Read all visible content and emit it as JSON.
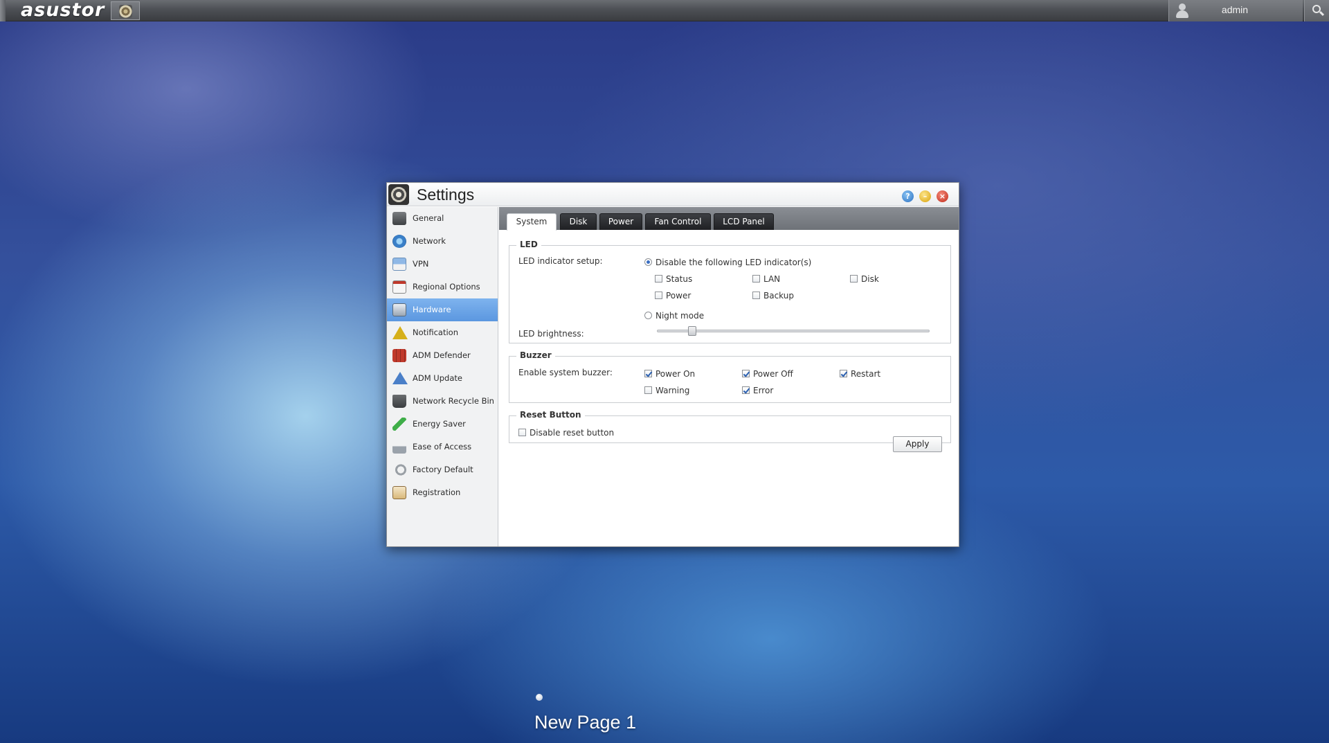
{
  "topbar": {
    "brand": "asustor",
    "user": "admin"
  },
  "window": {
    "title": "Settings",
    "sidebar": {
      "items": [
        {
          "label": "General",
          "icon": "general-icon"
        },
        {
          "label": "Network",
          "icon": "network-globe-icon"
        },
        {
          "label": "VPN",
          "icon": "vpn-house-icon"
        },
        {
          "label": "Regional Options",
          "icon": "calendar-clock-icon"
        },
        {
          "label": "Hardware",
          "icon": "hardware-icon",
          "active": true
        },
        {
          "label": "Notification",
          "icon": "warning-icon"
        },
        {
          "label": "ADM Defender",
          "icon": "firewall-icon"
        },
        {
          "label": "ADM Update",
          "icon": "update-arrow-icon"
        },
        {
          "label": "Network Recycle Bin",
          "icon": "recycle-bin-icon"
        },
        {
          "label": "Energy Saver",
          "icon": "leaf-icon"
        },
        {
          "label": "Ease of Access",
          "icon": "ease-access-icon"
        },
        {
          "label": "Factory Default",
          "icon": "undo-arrow-icon"
        },
        {
          "label": "Registration",
          "icon": "registration-icon"
        }
      ]
    },
    "tabs": [
      "System",
      "Disk",
      "Power",
      "Fan Control",
      "LCD Panel"
    ],
    "active_tab": "System",
    "led": {
      "legend": "LED",
      "setup_label": "LED indicator setup:",
      "disable_option": "Disable the following LED indicator(s)",
      "disable_selected": true,
      "indicators": [
        {
          "label": "Status",
          "checked": false
        },
        {
          "label": "LAN",
          "checked": false
        },
        {
          "label": "Disk",
          "checked": false
        },
        {
          "label": "Power",
          "checked": false
        },
        {
          "label": "Backup",
          "checked": false
        }
      ],
      "night_mode": "Night mode",
      "night_mode_selected": false,
      "brightness_label": "LED brightness:",
      "brightness_fraction": 0.13
    },
    "buzzer": {
      "legend": "Buzzer",
      "enable_label": "Enable system buzzer:",
      "options": [
        {
          "label": "Power On",
          "checked": true
        },
        {
          "label": "Power Off",
          "checked": true
        },
        {
          "label": "Restart",
          "checked": true
        },
        {
          "label": "Warning",
          "checked": false
        },
        {
          "label": "Error",
          "checked": true
        }
      ]
    },
    "reset": {
      "legend": "Reset Button",
      "disable_label": "Disable reset button",
      "checked": false
    },
    "apply_label": "Apply"
  },
  "desktop": {
    "page_label": "New Page 1"
  },
  "colors": {
    "active_nav": "#6fa8ea",
    "tab_dark": "#2b2d30",
    "check_blue": "#2a5fb0"
  }
}
